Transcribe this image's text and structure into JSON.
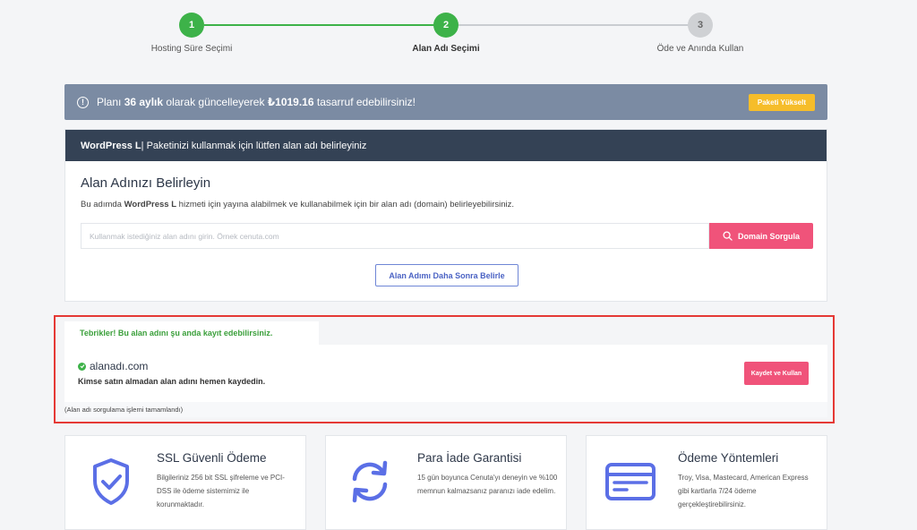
{
  "stepper": {
    "steps": [
      {
        "number": "1",
        "label": "Hosting Süre Seçimi"
      },
      {
        "number": "2",
        "label": "Alan Adı Seçimi"
      },
      {
        "number": "3",
        "label": "Öde ve Anında Kullan"
      }
    ],
    "active_step": 2
  },
  "promo": {
    "text_before": "Planı ",
    "months": "36 aylık",
    "text_middle": " olarak güncelleyerek ",
    "amount": "₺1019.16",
    "text_after": " tasarruf edebilirsiniz!",
    "button_label": "Paketi Yükselt"
  },
  "domain_card": {
    "header_plan": "WordPress L",
    "header_text": " | Paketinizi kullanmak için lütfen alan adı belirleyiniz",
    "title": "Alan Adınızı Belirleyin",
    "desc_before": "Bu adımda ",
    "desc_plan": "WordPress L",
    "desc_after": " hizmeti için yayına alabilmek ve kullanabilmek için bir alan adı (domain) belirleyebilirsiniz.",
    "search_placeholder": "Kullanmak istediğiniz alan adını girin. Örnek cenuta.com",
    "search_button": "Domain Sorgula",
    "later_button": "Alan Adımı Daha Sonra Belirle"
  },
  "result": {
    "tab_text": "Tebrikler! Bu alan adını şu anda kayıt edebilirsiniz.",
    "domain": "alanadı.com",
    "subtitle": "Kimse satın almadan alan adını hemen kaydedin.",
    "register_button": "Kaydet ve Kullan",
    "footer": "(Alan adı sorgulama işlemi tamamlandı)"
  },
  "features": [
    {
      "icon": "shield-check-icon",
      "title": "SSL Güvenli Ödeme",
      "desc": "Bilgileriniz 256 bit SSL şifreleme ve PCI-DSS ile ödeme sistemimiz ile korunmaktadır."
    },
    {
      "icon": "refresh-icon",
      "title": "Para İade Garantisi",
      "desc": "15 gün boyunca Cenuta'yı deneyin ve %100 memnun kalmazsanız paranızı iade edelim."
    },
    {
      "icon": "credit-card-icon",
      "title": "Ödeme Yöntemleri",
      "desc": "Troy, Visa, Mastecard, American Express gibi kartlarla 7/24 ödeme gerçekleştirebilirsiniz."
    }
  ],
  "colors": {
    "accent_green": "#3db249",
    "accent_pink": "#f0537a",
    "icon_blue": "#5b6fe6",
    "header_dark": "#344255",
    "promo_bg": "#7b8ba3",
    "highlight_red": "#e53935"
  }
}
